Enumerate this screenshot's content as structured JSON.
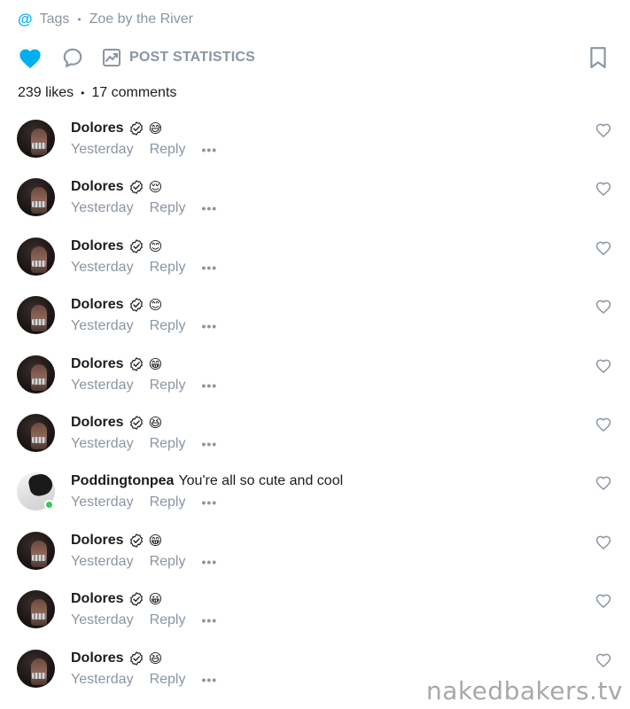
{
  "header": {
    "tags_icon": "at-icon",
    "tags_label": "Tags",
    "linked_title": "Zoe by the River"
  },
  "actions": {
    "like_icon": "heart-filled-icon",
    "comment_icon": "comment-bubble-icon",
    "stats_icon": "chart-trend-icon",
    "stats_label": "POST STATISTICS",
    "bookmark_icon": "bookmark-icon",
    "accent_color": "#00aff0"
  },
  "counts": {
    "likes": "239 likes",
    "comments": "17 comments"
  },
  "comments": [
    {
      "name": "Dolores",
      "verified": true,
      "emoji": "😅",
      "text": "",
      "time": "Yesterday",
      "reply": "Reply",
      "more": "•••"
    },
    {
      "name": "Dolores",
      "verified": true,
      "emoji": "😌",
      "text": "",
      "time": "Yesterday",
      "reply": "Reply",
      "more": "•••"
    },
    {
      "name": "Dolores",
      "verified": true,
      "emoji": "😊",
      "text": "",
      "time": "Yesterday",
      "reply": "Reply",
      "more": "•••"
    },
    {
      "name": "Dolores",
      "verified": true,
      "emoji": "😊",
      "text": "",
      "time": "Yesterday",
      "reply": "Reply",
      "more": "•••"
    },
    {
      "name": "Dolores",
      "verified": true,
      "emoji": "😁",
      "text": "",
      "time": "Yesterday",
      "reply": "Reply",
      "more": "•••"
    },
    {
      "name": "Dolores",
      "verified": true,
      "emoji": "😆",
      "text": "",
      "time": "Yesterday",
      "reply": "Reply",
      "more": "•••"
    },
    {
      "name": "Poddingtonpea",
      "verified": false,
      "emoji": "",
      "text": "You're all so cute and cool",
      "time": "Yesterday",
      "reply": "Reply",
      "more": "•••",
      "online": true
    },
    {
      "name": "Dolores",
      "verified": true,
      "emoji": "😁",
      "text": "",
      "time": "Yesterday",
      "reply": "Reply",
      "more": "•••"
    },
    {
      "name": "Dolores",
      "verified": true,
      "emoji": "😀",
      "text": "",
      "time": "Yesterday",
      "reply": "Reply",
      "more": "•••"
    },
    {
      "name": "Dolores",
      "verified": true,
      "emoji": "😆",
      "text": "",
      "time": "Yesterday",
      "reply": "Reply",
      "more": "•••"
    }
  ],
  "watermark": "nakedbakers.tv"
}
